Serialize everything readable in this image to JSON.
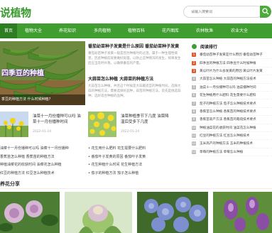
{
  "site": {
    "logo_text": "说植物"
  },
  "search": {
    "placeholder": "请输入搜索词"
  },
  "nav": {
    "items": [
      "首页",
      "植物大全",
      "养花知识",
      "多肉植物",
      "植物百科",
      "花卉图库",
      "农林牧渔",
      "农业大全"
    ]
  },
  "hero": {
    "title": "四季豆的种植",
    "caption": "季豆的种植方法 什么时候种植?"
  },
  "featured": [
    {
      "title": "番茄幼苗种子发黄是什么原因 番茄幼苗种子发黄",
      "desc": "番茄幼苗种子发黄一般是因为种植时的过湿，属于一种生理性病害，因此种植前就要做好处理，以防止这种情况的发生。如果发生后应当及时补救，以确保番茄的产量。"
    },
    {
      "title": "大蒜苗怎么种植 大蒜苗的种植方法",
      "desc": "大蒜苗怎么种植，并且这个时候是大蒜最适宜的种植时间，选择大蒜的种植方法，需要选择好品种，蒜苗的种植方法，首先是挑选蒜种，选好适合种植的品种。"
    }
  ],
  "cards": [
    {
      "title": "油菜十一月份播种可以吗 油菜十一月份播种时间",
      "date": "2022-01-24"
    },
    {
      "title": "油菜种植季节下几度 油菜降温后受多下几度",
      "date": "2022-01-24"
    }
  ],
  "links_left": [
    "油菜十一月份播种可以吗 油菜十一月份播种",
    "香蕉苗怎么种植 香蕉苗的种植方法",
    "种植油菜花的收获时间 油菜花怎么种植",
    "红豆的种植方法 红豆怎么种植技术"
  ],
  "links_mid": [
    "花生用什么肥料 花生需要什么肥料",
    "番茄叶子发黄的原因 番茄叶子发黄",
    "花生种植什么时间 花生种植方法",
    "茄子的种植方法 茄子怎么种植"
  ],
  "sidebar": {
    "heading": "阅读排行",
    "items": [
      "番茄幼苗种子发黄是什么原因 番茄幼苗种子",
      "四季豆的种植方法 四季豆什么时候种植",
      "黄瓜叶片为什么会发黄的原因 黄瓜叶片发黄",
      "大蒜苗怎么种植 大蒜苗的种植方法技术",
      "油菜十一月份播种可以吗 油菜播种时间",
      "花生种植用什么肥料 花生需要什么肥料",
      "茄子的种植方法 茄子怎么种植技术要点",
      "香蕉苗怎么种植 香蕉苗的种植技术要点",
      "香蕉苗高产方法 香蕉苗的栽培技术要点",
      "种植油菜花的收获时间 油菜花怎么种植",
      "红豆的种植方法 红豆怎么种植技术",
      "玉米高产的种植方法 玉米的种植技术",
      "草莓的种植方法 草莓怎么种植"
    ]
  },
  "gallery": {
    "title": "养花分享"
  },
  "colors": {
    "brand": "#3f9e2f",
    "nav_active": "#2e7d22",
    "hot": "#e05a2b"
  }
}
